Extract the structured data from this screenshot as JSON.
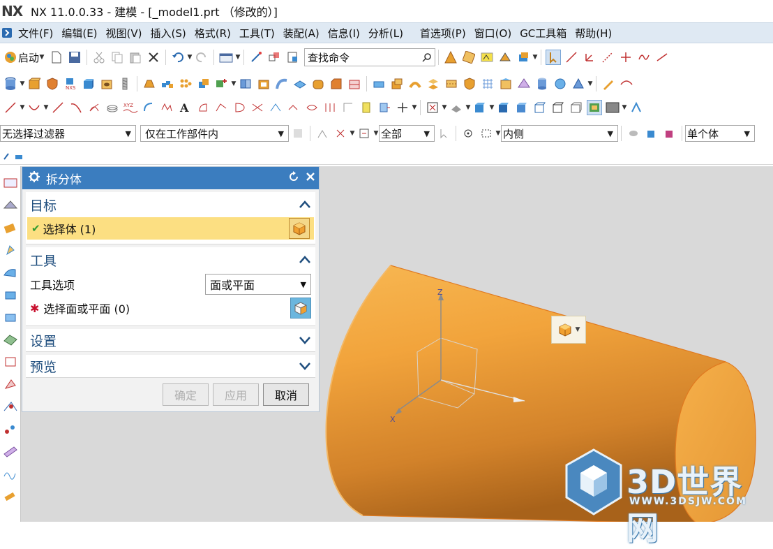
{
  "window": {
    "logo": "NX",
    "title": "NX 11.0.0.33 - 建模 - [_model1.prt （修改的）]"
  },
  "menubar": {
    "items": [
      "文件(F)",
      "编辑(E)",
      "视图(V)",
      "插入(S)",
      "格式(R)",
      "工具(T)",
      "装配(A)",
      "信息(I)",
      "分析(L)",
      "首选项(P)",
      "窗口(O)",
      "GC工具箱",
      "帮助(H)"
    ]
  },
  "toolbar": {
    "start_label": "启动",
    "search_placeholder": "查找命令"
  },
  "filterbar": {
    "type_filter": "无选择过滤器",
    "scope_filter": "仅在工作部件内",
    "all_filter": "全部",
    "inside_filter": "内侧",
    "body_filter": "单个体"
  },
  "dialog": {
    "title": "拆分体",
    "target_section": "目标",
    "select_body": "选择体 (1)",
    "tool_section": "工具",
    "tool_option_label": "工具选项",
    "tool_option_value": "面或平面",
    "select_face": "选择面或平面 (0)",
    "settings_section": "设置",
    "preview_section": "预览",
    "ok_label": "确定",
    "apply_label": "应用",
    "cancel_label": "取消"
  },
  "viewport": {
    "axis_z": "Z",
    "axis_x": "X",
    "cylinder_color": "#f0a040"
  },
  "watermark": {
    "brand": "3D世界网",
    "url": "WWW.3DSJW.COM"
  },
  "colors": {
    "dialog_header": "#3b7dbf",
    "selection_highlight": "#fcdf82",
    "section_title": "#1f4e7e"
  }
}
